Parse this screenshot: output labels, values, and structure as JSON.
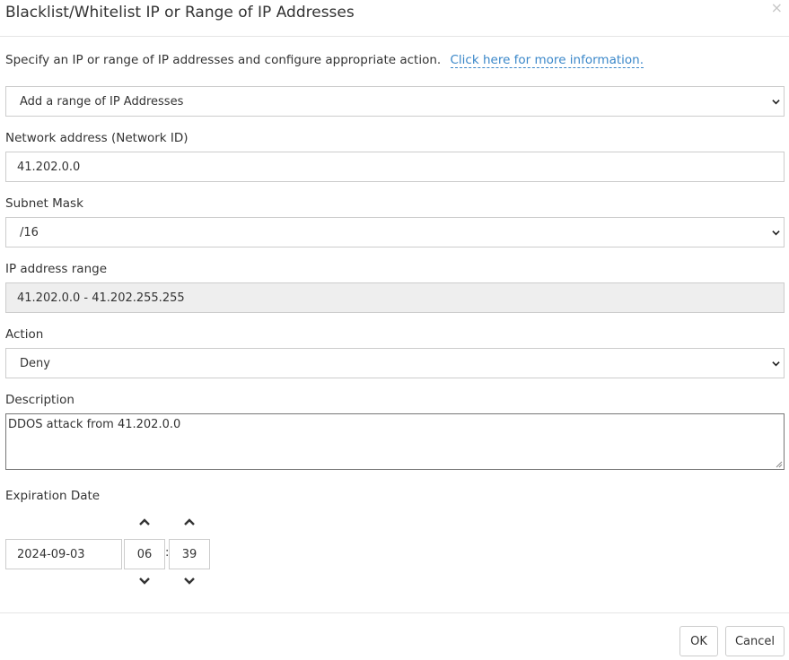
{
  "dialog": {
    "title": "Blacklist/Whitelist IP or Range of IP Addresses",
    "close_icon": "×",
    "intro": "Specify an IP or range of IP addresses and configure appropriate action.",
    "info_link": "Click here for more information."
  },
  "form": {
    "type_select": {
      "value": "Add a range of IP Addresses"
    },
    "network_address": {
      "label": "Network address (Network ID)",
      "value": "41.202.0.0"
    },
    "subnet_mask": {
      "label": "Subnet Mask",
      "value": "/16"
    },
    "ip_range": {
      "label": "IP address range",
      "value": "41.202.0.0 - 41.202.255.255"
    },
    "action": {
      "label": "Action",
      "value": "Deny"
    },
    "description": {
      "label": "Description",
      "value": "DDOS attack from 41.202.0.0"
    },
    "expiration": {
      "label": "Expiration Date",
      "date": "2024-09-03",
      "hour": "06",
      "minute": "39",
      "separator": ":"
    }
  },
  "footer": {
    "ok_label": "OK",
    "cancel_label": "Cancel"
  },
  "colors": {
    "link": "#3a87c9",
    "border": "#cccccc",
    "readonly_bg": "#eeeeee"
  }
}
